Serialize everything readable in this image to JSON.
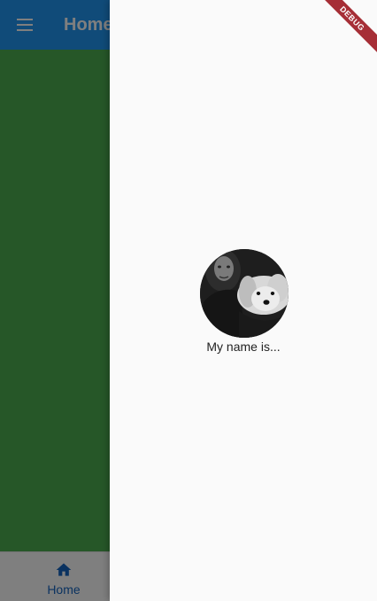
{
  "app_bar": {
    "title": "Home",
    "menu_icon": "menu-icon",
    "color": "#2196f3"
  },
  "body": {
    "color": "#4caf50"
  },
  "bottom_nav": {
    "items": [
      {
        "label": "Home",
        "icon": "home-icon",
        "color": "#1565c0"
      }
    ]
  },
  "drawer": {
    "avatar": "avatar",
    "label": "My name is..."
  },
  "debug_banner": {
    "label": "DEBUG",
    "color": "#a62e36"
  }
}
